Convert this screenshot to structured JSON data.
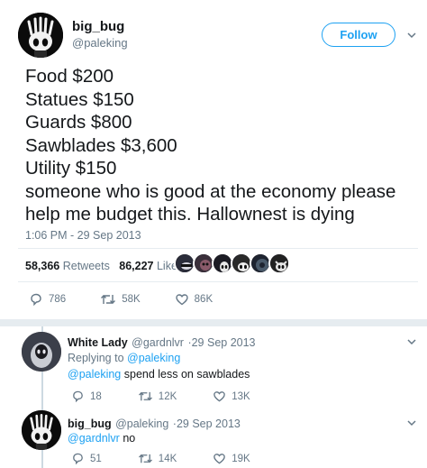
{
  "tweet": {
    "display_name": "big_bug",
    "handle": "@paleking",
    "follow_label": "Follow",
    "lines": [
      "Food $200",
      "Statues $150",
      "Guards $800",
      "Sawblades $3,600",
      "Utility $150",
      "someone who is good at the economy please",
      "help me budget this. Hallownest is dying"
    ],
    "timestamp": "1:06 PM - 29 Sep 2013",
    "retweets_count": "58,366",
    "retweets_label": "Retweets",
    "likes_count": "86,227",
    "likes_label": "Likes",
    "reply_count": "786",
    "retweet_count_short": "58K",
    "like_count_short": "86K"
  },
  "replies": [
    {
      "display_name": "White Lady",
      "handle": "@gardnlvr",
      "date": "·29 Sep 2013",
      "replying_prefix": "Replying to",
      "replying_to": "@paleking",
      "mention": "@paleking",
      "text": " spend less on sawblades",
      "reply_count": "18",
      "retweet_count": "12K",
      "like_count": "13K"
    },
    {
      "display_name": "big_bug",
      "handle": "@paleking",
      "date": "·29 Sep 2013",
      "mention": "@gardnlvr",
      "text": " no",
      "reply_count": "51",
      "retweet_count": "14K",
      "like_count": "19K"
    }
  ],
  "colors": {
    "link": "#1da1f2",
    "muted": "#657786",
    "text": "#14171a",
    "divider": "#e6ecf0"
  }
}
